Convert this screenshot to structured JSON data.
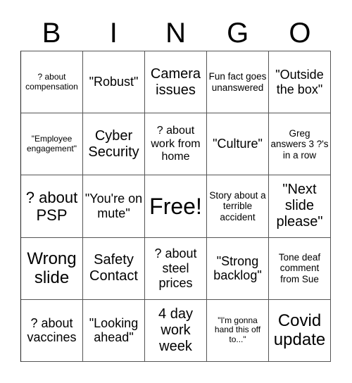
{
  "header": [
    "B",
    "I",
    "N",
    "G",
    "O"
  ],
  "cells": [
    "? about compensation",
    "\"Robust\"",
    "Camera issues",
    "Fun fact goes unanswered",
    "\"Outside the box\"",
    "\"Employee engagement\"",
    "Cyber Security",
    "? about work from home",
    "\"Culture\"",
    "Greg answers 3 ?'s in a row",
    "? about PSP",
    "\"You're on mute\"",
    "Free!",
    "Story about a terrible accident",
    "\"Next slide please\"",
    "Wrong slide",
    "Safety Contact",
    "? about steel prices",
    "\"Strong backlog\"",
    "Tone deaf comment from Sue",
    "? about vaccines",
    "\"Looking ahead\"",
    "4 day work week",
    "\"I'm gonna hand this off to...\"",
    "Covid update"
  ]
}
